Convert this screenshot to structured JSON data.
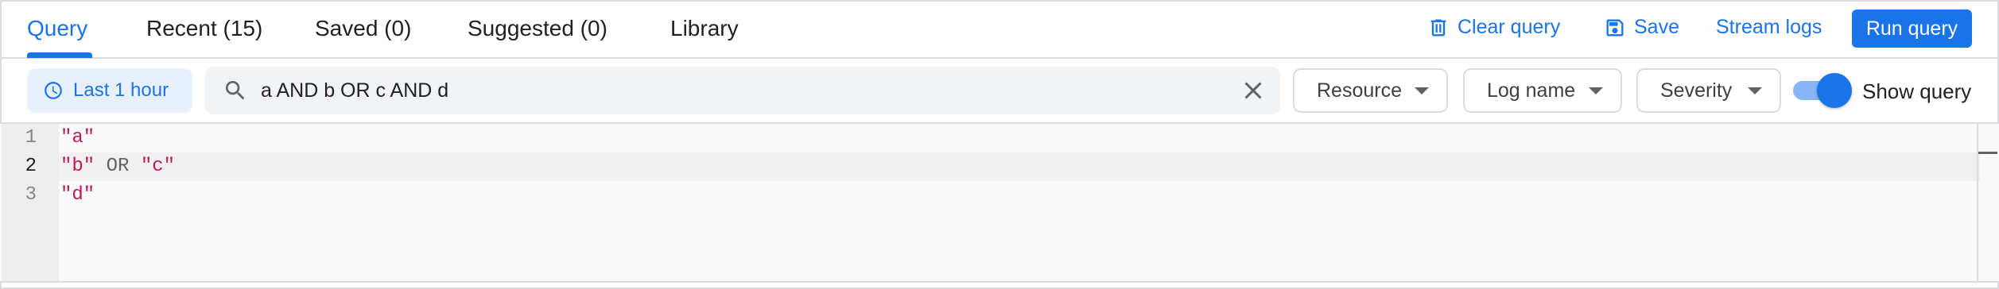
{
  "tabs": [
    {
      "label": "Query"
    },
    {
      "label": "Recent (15)"
    },
    {
      "label": "Saved (0)"
    },
    {
      "label": "Suggested (0)"
    },
    {
      "label": "Library"
    }
  ],
  "actions": {
    "clear_label": "Clear query",
    "save_label": "Save",
    "stream_label": "Stream logs",
    "run_label": "Run query"
  },
  "filters": {
    "time_label": "Last 1 hour",
    "search_value": "a AND b OR c AND d",
    "resource_label": "Resource",
    "logname_label": "Log name",
    "severity_label": "Severity",
    "show_query_label": "Show query",
    "show_query_on": true
  },
  "editor": {
    "line_numbers": [
      "1",
      "2",
      "3"
    ],
    "lines": [
      [
        {
          "text": "\"a\"",
          "kind": "string"
        }
      ],
      [
        {
          "text": "\"b\"",
          "kind": "string"
        },
        {
          "text": " OR ",
          "kind": "keyword"
        },
        {
          "text": "\"c\"",
          "kind": "string"
        }
      ],
      [
        {
          "text": "\"d\"",
          "kind": "string"
        }
      ]
    ]
  },
  "colors": {
    "accent": "#1a73e8",
    "string": "#c2185b",
    "keyword": "#5f6368"
  },
  "icons": [
    "trash-icon",
    "save-icon",
    "clock-icon",
    "search-icon",
    "close-icon",
    "chevron-down-icon"
  ]
}
